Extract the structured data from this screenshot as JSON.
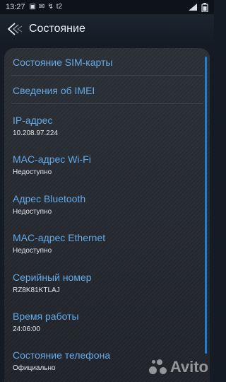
{
  "status_bar": {
    "time": "13:27",
    "carrier": "t2"
  },
  "header": {
    "title": "Состояние"
  },
  "items": [
    {
      "title": "Состояние SIM-карты",
      "value": ""
    },
    {
      "title": "Сведения об IMEI",
      "value": ""
    },
    {
      "title": "IP-адрес",
      "value": "10.208.97.224"
    },
    {
      "title": "MAC-адрес Wi-Fi",
      "value": "Недоступно"
    },
    {
      "title": "Адрес Bluetooth",
      "value": "Недоступно"
    },
    {
      "title": "MAC-адрес Ethernet",
      "value": "Недоступно"
    },
    {
      "title": "Серийный номер",
      "value": "RZ8K81KTLAJ"
    },
    {
      "title": "Время работы",
      "value": "24:06:00"
    },
    {
      "title": "Состояние телефона",
      "value": "Официально"
    }
  ],
  "watermark": "Avito",
  "colors": {
    "accent": "#64a9e8",
    "scrollbar": "#1e7fd8"
  }
}
